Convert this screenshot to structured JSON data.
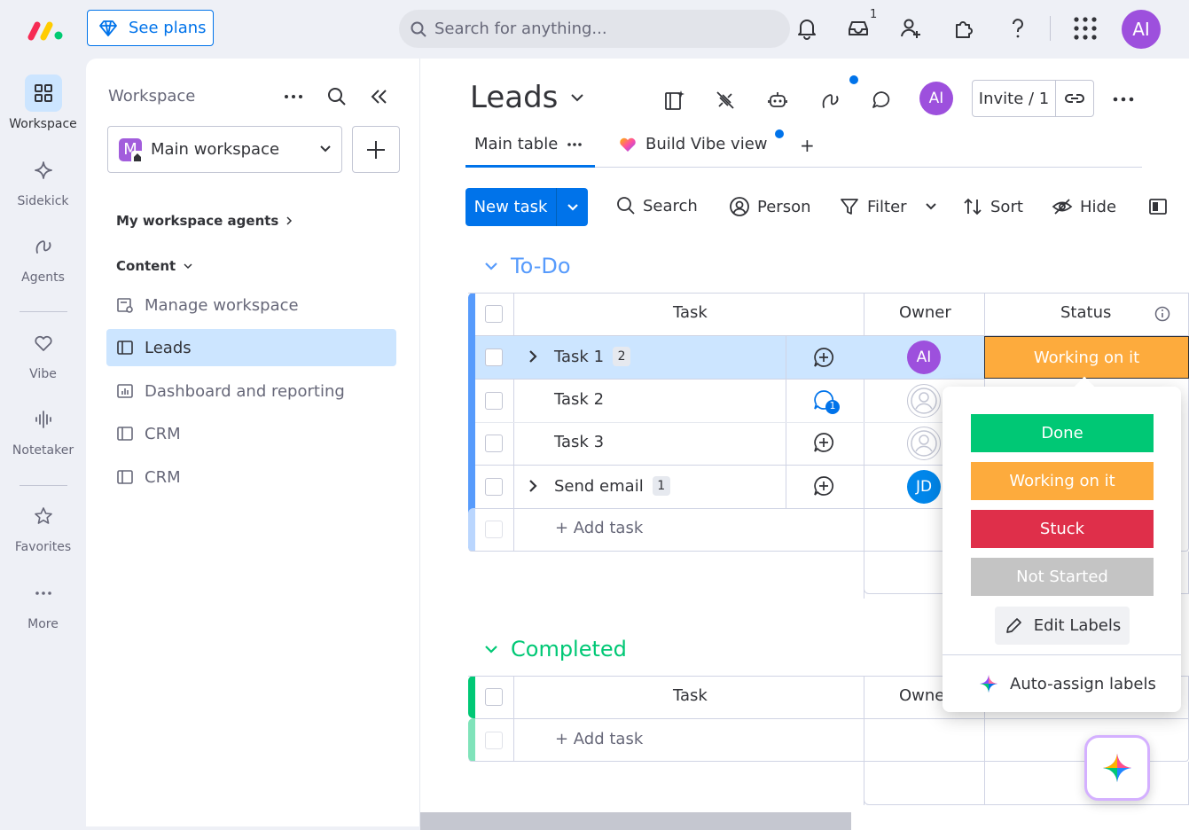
{
  "topbar": {
    "see_plans": "See plans",
    "search_placeholder": "Search for anything...",
    "inbox_badge": "1",
    "user_initials": "AI"
  },
  "leftnav": {
    "items": [
      {
        "label": "Workspace",
        "icon": "grid-icon"
      },
      {
        "label": "Sidekick",
        "icon": "sparkle-icon"
      },
      {
        "label": "Agents",
        "icon": "agents-icon"
      },
      {
        "label": "Vibe",
        "icon": "heart-icon"
      },
      {
        "label": "Notetaker",
        "icon": "audio-wave-icon"
      },
      {
        "label": "Favorites",
        "icon": "star-icon"
      },
      {
        "label": "More",
        "icon": "dots-icon"
      }
    ]
  },
  "workspace_panel": {
    "title": "Workspace",
    "selected_workspace": "Main workspace",
    "workspace_initial": "M",
    "agents_header": "My workspace agents",
    "content_header": "Content",
    "items": [
      {
        "label": "Manage workspace",
        "icon": "manage-icon"
      },
      {
        "label": "Leads",
        "icon": "board-icon"
      },
      {
        "label": "Dashboard and reporting",
        "icon": "dashboard-icon"
      },
      {
        "label": "CRM",
        "icon": "board-icon"
      },
      {
        "label": "CRM",
        "icon": "board-icon"
      }
    ]
  },
  "board": {
    "title": "Leads",
    "user_initials": "AI",
    "invite_label": "Invite / 1",
    "tabs": [
      {
        "label": "Main table"
      },
      {
        "label": "Build Vibe view"
      }
    ],
    "add_tab": "+",
    "new_task": "New task",
    "toolbar": {
      "search": "Search",
      "person": "Person",
      "filter": "Filter",
      "sort": "Sort",
      "hide": "Hide"
    }
  },
  "groups": {
    "todo": {
      "title": "To-Do",
      "color": "#579bfc",
      "columns": {
        "task": "Task",
        "owner": "Owner",
        "status": "Status"
      },
      "rows": [
        {
          "task": "Task 1",
          "count": "2",
          "owner": "AI",
          "status": "Working on it"
        },
        {
          "task": "Task 2",
          "updates": "1"
        },
        {
          "task": "Task 3"
        },
        {
          "task": "Send email",
          "count": "1",
          "owner": "JD"
        }
      ],
      "add_task": "+ Add task"
    },
    "completed": {
      "title": "Completed",
      "color": "#00c875",
      "columns": {
        "task": "Task",
        "owner": "Owne"
      },
      "add_task": "+ Add task"
    }
  },
  "status_popup": {
    "labels": [
      {
        "label": "Done",
        "color": "#00c875"
      },
      {
        "label": "Working on it",
        "color": "#fdab3d"
      },
      {
        "label": "Stuck",
        "color": "#df2f4a"
      },
      {
        "label": "Not Started",
        "color": "#c4c4c4"
      }
    ],
    "edit_labels": "Edit Labels",
    "auto_assign": "Auto-assign labels"
  }
}
